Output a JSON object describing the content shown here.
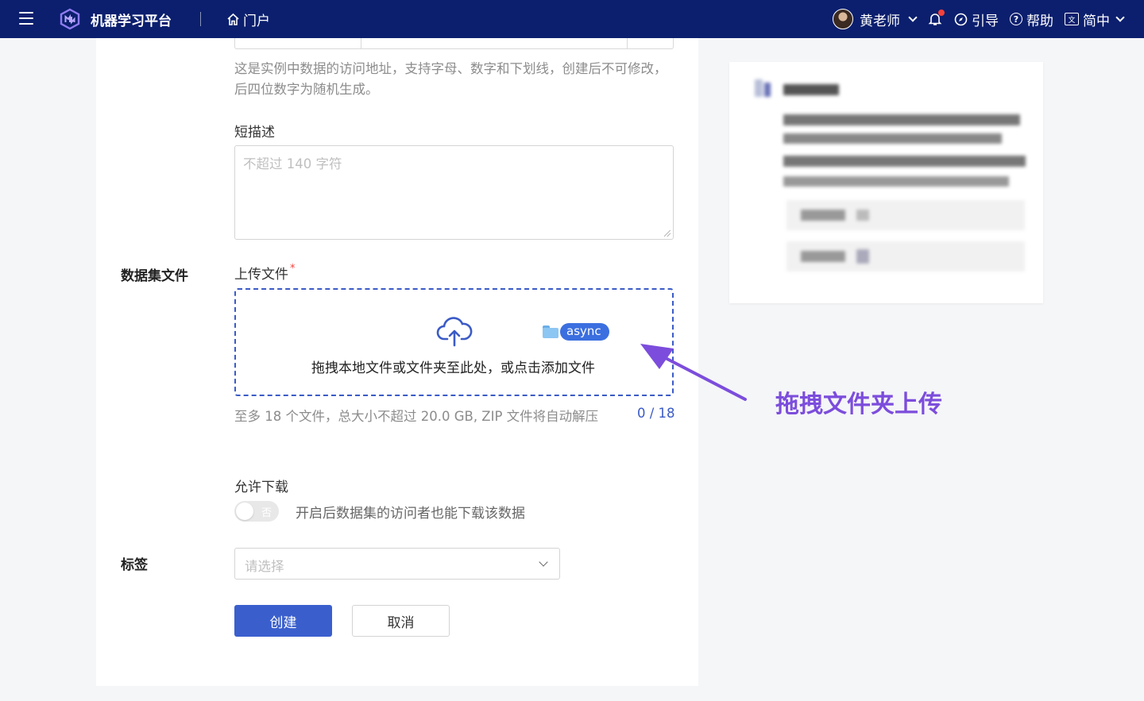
{
  "topbar": {
    "app_title": "机器学习平台",
    "portal_label": "门户",
    "user_name": "黄老师",
    "guide_label": "引导",
    "help_label": "帮助",
    "language_label": "简中",
    "bg_color": "#0b1f6e"
  },
  "form": {
    "slug_help": "这是实例中数据的访问地址，支持字母、数字和下划线，创建后不可修改，后四位数字为随机生成。",
    "short_desc_label": "短描述",
    "short_desc_placeholder": "不超过 140 字符",
    "dataset_files_section": "数据集文件",
    "upload_label": "上传文件",
    "required_mark": "*",
    "dropzone_text": "拖拽本地文件或文件夹至此处，或点击添加文件",
    "dragging_folder_name": "async",
    "upload_hint": "至多 18 个文件，总大小不超过 20.0 GB, ZIP 文件将自动解压",
    "upload_count": "0 / 18",
    "allow_download_label": "允许下载",
    "allow_download_toggle_text": "否",
    "allow_download_enabled": false,
    "allow_download_desc": "开启后数据集的访问者也能下载该数据",
    "tags_section": "标签",
    "tags_placeholder": "请选择",
    "create_button": "创建",
    "cancel_button": "取消"
  },
  "annotation": {
    "text": "拖拽文件夹上传",
    "color": "#7c4ddc"
  },
  "colors": {
    "primary": "#3a5fcd",
    "dropzone_border": "#3b5bc6",
    "required": "#f5413b"
  }
}
